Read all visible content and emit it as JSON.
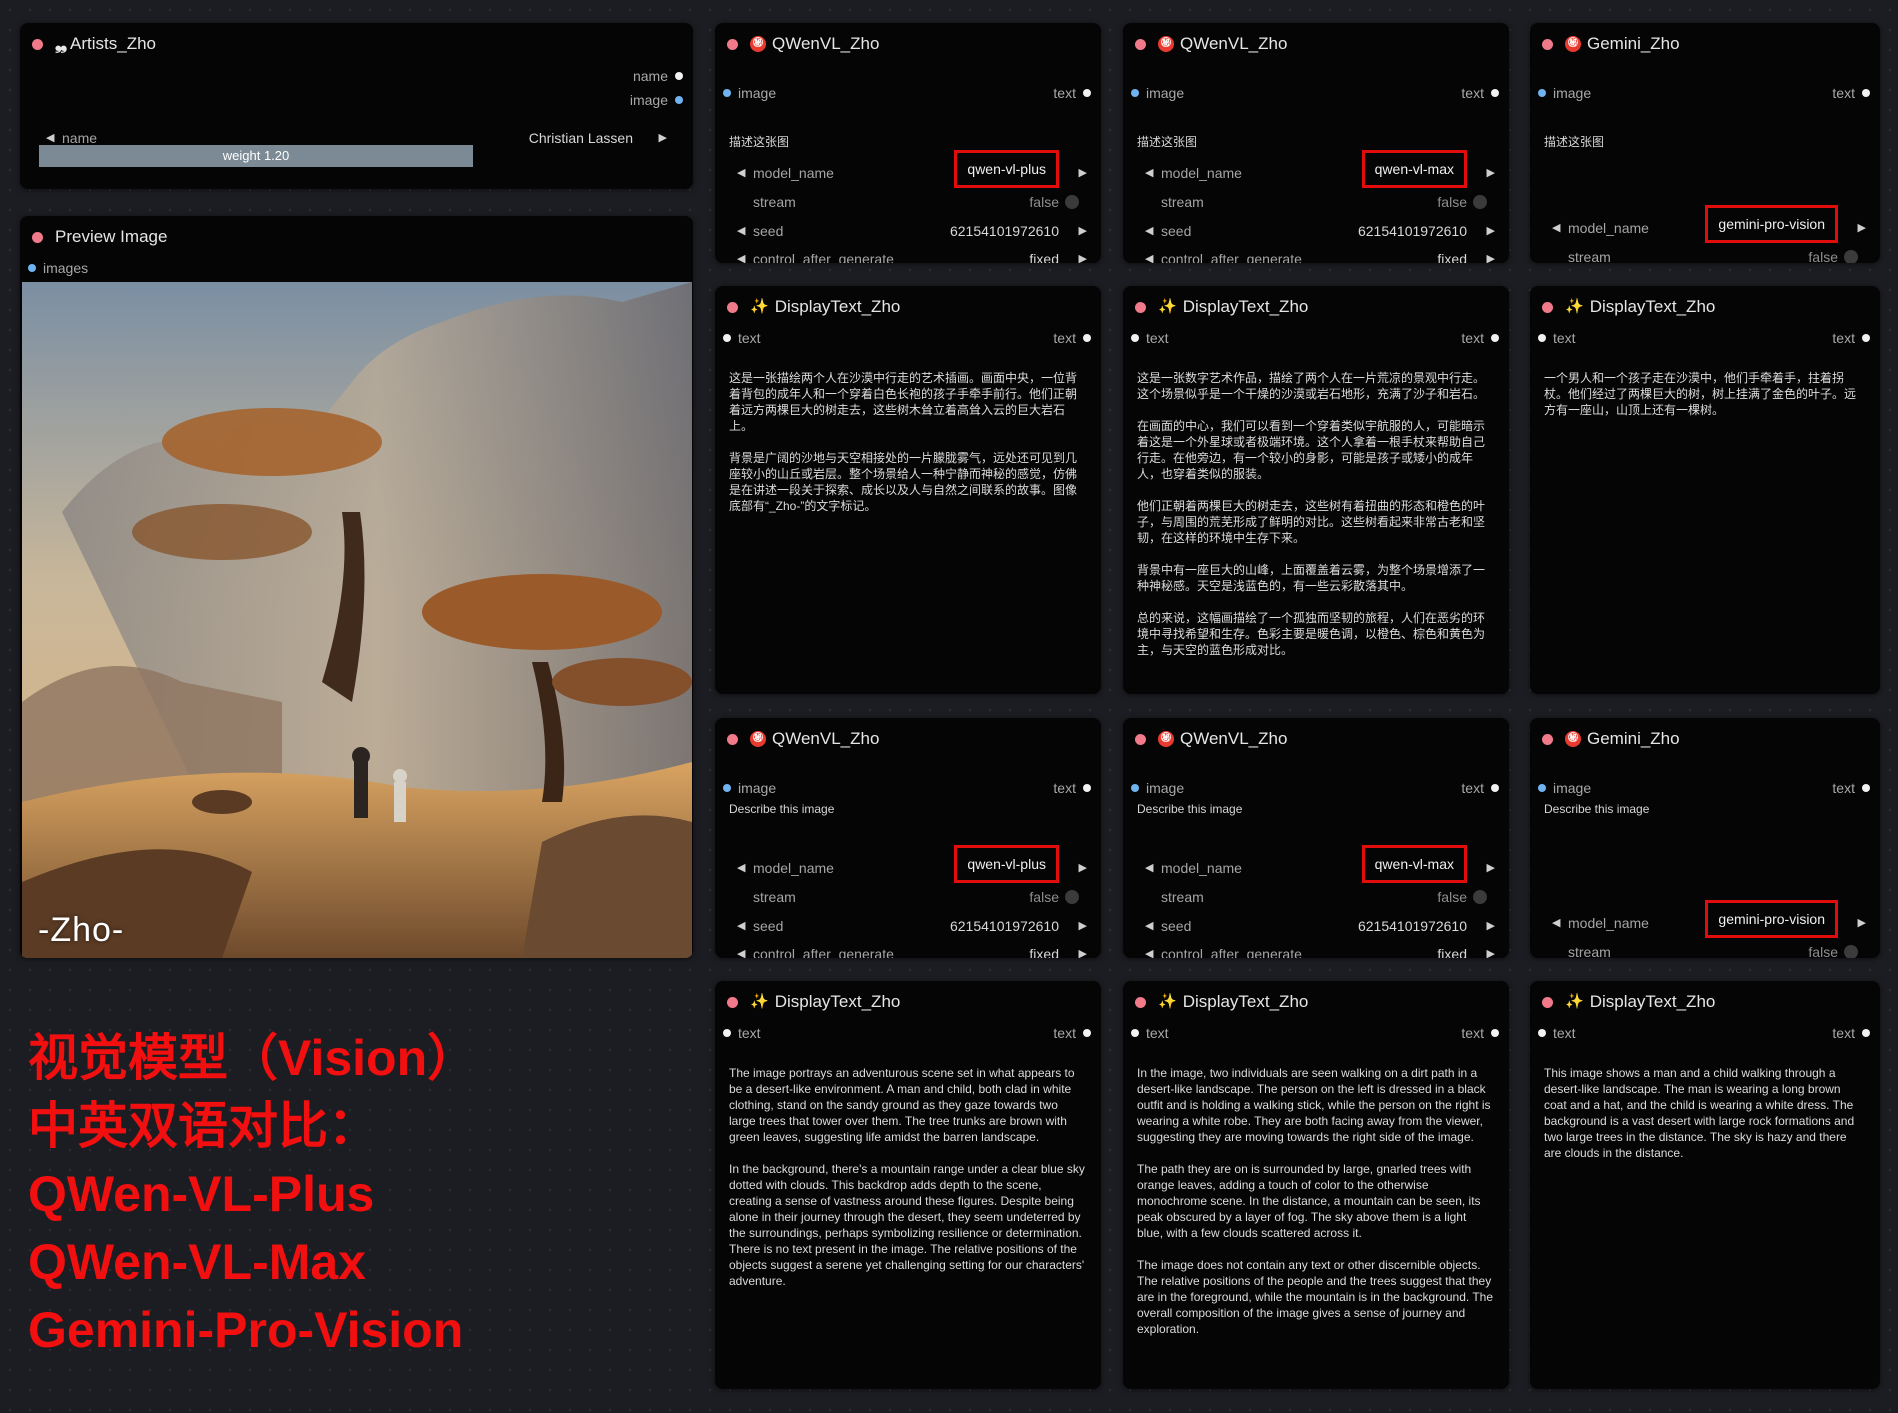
{
  "artists_node": {
    "title": "Artists_Zho",
    "out_name": "name",
    "out_image": "image",
    "name_label": "name",
    "name_value": "Christian Lassen",
    "weight": "weight  1.20"
  },
  "preview_node": {
    "title": "Preview Image",
    "input": "images",
    "watermark": "-Zho-"
  },
  "vision_nodes": [
    {
      "title": "QWenVL_Zho",
      "input": "image",
      "output": "text",
      "prompt": "描述这张图",
      "model_label": "model_name",
      "model_value": "qwen-vl-plus",
      "stream_label": "stream",
      "stream_value": "false",
      "seed_label": "seed",
      "seed_value": "62154101972610",
      "control_label": "control_after_generate",
      "control_value": "fixed"
    },
    {
      "title": "QWenVL_Zho",
      "input": "image",
      "output": "text",
      "prompt": "描述这张图",
      "model_label": "model_name",
      "model_value": "qwen-vl-max",
      "stream_label": "stream",
      "stream_value": "false",
      "seed_label": "seed",
      "seed_value": "62154101972610",
      "control_label": "control_after_generate",
      "control_value": "fixed"
    },
    {
      "title": "Gemini_Zho",
      "input": "image",
      "output": "text",
      "prompt": "描述这张图",
      "model_label": "model_name",
      "model_value": "gemini-pro-vision",
      "stream_label": "stream",
      "stream_value": "false"
    },
    {
      "title": "QWenVL_Zho",
      "input": "image",
      "output": "text",
      "prompt": "Describe this image",
      "model_label": "model_name",
      "model_value": "qwen-vl-plus",
      "stream_label": "stream",
      "stream_value": "false",
      "seed_label": "seed",
      "seed_value": "62154101972610",
      "control_label": "control_after_generate",
      "control_value": "fixed"
    },
    {
      "title": "QWenVL_Zho",
      "input": "image",
      "output": "text",
      "prompt": "Describe this image",
      "model_label": "model_name",
      "model_value": "qwen-vl-max",
      "stream_label": "stream",
      "stream_value": "false",
      "seed_label": "seed",
      "seed_value": "62154101972610",
      "control_label": "control_after_generate",
      "control_value": "fixed"
    },
    {
      "title": "Gemini_Zho",
      "input": "image",
      "output": "text",
      "prompt": "Describe this image",
      "model_label": "model_name",
      "model_value": "gemini-pro-vision",
      "stream_label": "stream",
      "stream_value": "false"
    }
  ],
  "display_nodes": [
    {
      "title": "DisplayText_Zho",
      "input": "text",
      "output": "text",
      "body": "这是一张描绘两个人在沙漠中行走的艺术插画。画面中央，一位背着背包的成年人和一个穿着白色长袍的孩子手牵手前行。他们正朝着远方两棵巨大的树走去，这些树木耸立着高耸入云的巨大岩石上。\n\n背景是广阔的沙地与天空相接处的一片朦胧雾气，远处还可见到几座较小的山丘或岩层。整个场景给人一种宁静而神秘的感觉，仿佛是在讲述一段关于探索、成长以及人与自然之间联系的故事。图像底部有“_Zho-”的文字标记。"
    },
    {
      "title": "DisplayText_Zho",
      "input": "text",
      "output": "text",
      "body": "这是一张数字艺术作品，描绘了两个人在一片荒凉的景观中行走。这个场景似乎是一个干燥的沙漠或岩石地形，充满了沙子和岩石。\n\n在画面的中心，我们可以看到一个穿着类似宇航服的人，可能暗示着这是一个外星球或者极端环境。这个人拿着一根手杖来帮助自己行走。在他旁边，有一个较小的身影，可能是孩子或矮小的成年人，也穿着类似的服装。\n\n他们正朝着两棵巨大的树走去，这些树有着扭曲的形态和橙色的叶子，与周围的荒芜形成了鲜明的对比。这些树看起来非常古老和坚韧，在这样的环境中生存下来。\n\n背景中有一座巨大的山峰，上面覆盖着云雾，为整个场景增添了一种神秘感。天空是浅蓝色的，有一些云彩散落其中。\n\n总的来说，这幅画描绘了一个孤独而坚韧的旅程，人们在恶劣的环境中寻找希望和生存。色彩主要是暖色调，以橙色、棕色和黄色为主，与天空的蓝色形成对比。"
    },
    {
      "title": "DisplayText_Zho",
      "input": "text",
      "output": "text",
      "body": "一个男人和一个孩子走在沙漠中，他们手牵着手，拄着拐杖。他们经过了两棵巨大的树，树上挂满了金色的叶子。远方有一座山，山顶上还有一棵树。"
    },
    {
      "title": "DisplayText_Zho",
      "input": "text",
      "output": "text",
      "body": "The image portrays an adventurous scene set in what appears to be a desert-like environment. A man and child, both clad in white clothing, stand on the sandy ground as they gaze towards two large trees that tower over them. The tree trunks are brown with green leaves, suggesting life amidst the barren landscape.\n\nIn the background, there's a mountain range under a clear blue sky dotted with clouds. This backdrop adds depth to the scene, creating a sense of vastness around these figures. Despite being alone in their journey through the desert, they seem undeterred by the surroundings, perhaps symbolizing resilience or determination. There is no text present in the image. The relative positions of the objects suggest a serene yet challenging setting for our characters' adventure."
    },
    {
      "title": "DisplayText_Zho",
      "input": "text",
      "output": "text",
      "body": "In the image, two individuals are seen walking on a dirt path in a desert-like landscape. The person on the left is dressed in a black outfit and is holding a walking stick, while the person on the right is wearing a white robe. They are both facing away from the viewer, suggesting they are moving towards the right side of the image.\n\nThe path they are on is surrounded by large, gnarled trees with orange leaves, adding a touch of color to the otherwise monochrome scene. In the distance, a mountain can be seen, its peak obscured by a layer of fog. The sky above them is a light blue, with a few clouds scattered across it.\n\nThe image does not contain any text or other discernible objects. The relative positions of the people and the trees suggest that they are in the foreground, while the mountain is in the background. The overall composition of the image gives a sense of journey and exploration."
    },
    {
      "title": "DisplayText_Zho",
      "input": "text",
      "output": "text",
      "body": "This image shows a man and a child walking through a desert-like landscape. The man is wearing a long brown coat and a hat, and the child is wearing a white dress. The background is a vast desert with large rock formations and two large trees in the distance. The sky is hazy and there are clouds in the distance."
    }
  ],
  "caption": {
    "line1": "视觉模型（Vision）",
    "line2": "中英双语对比：",
    "line3": "QWen-VL-Plus",
    "line4": "QWen-VL-Max",
    "line5": "Gemini-Pro-Vision"
  },
  "colors": {
    "highlight": "#e10d0d",
    "caption": "#f20f0f",
    "node_bg": "#050505",
    "canvas_bg": "#1c1d22",
    "title_dot": "#f07a8a",
    "input_dot": "#6fb4f0"
  },
  "icons": {
    "artists": "quote-icon",
    "qwen": "secret-badge-icon",
    "gemini": "secret-badge-icon",
    "display": "sparkle-icon"
  }
}
